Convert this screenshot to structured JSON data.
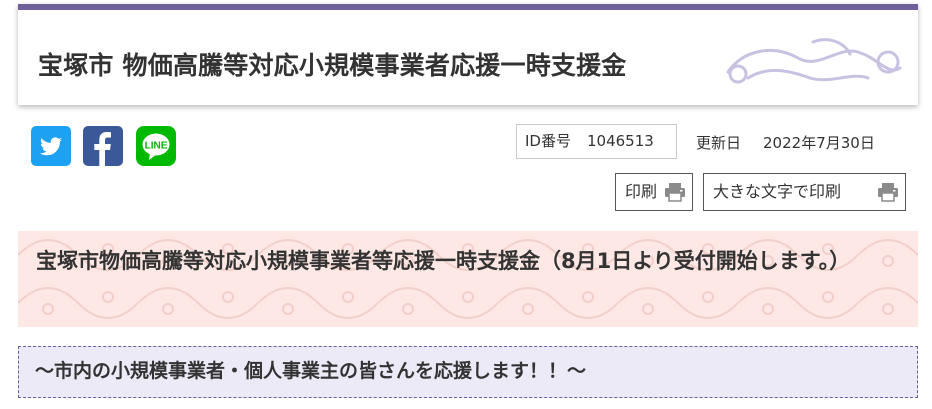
{
  "page": {
    "title": "宝塚市 物価高騰等対応小規模事業者応援一時支援金"
  },
  "share": {
    "twitter_icon": "twitter-icon",
    "facebook_icon": "facebook-icon",
    "line_icon": "line-icon",
    "line_label": "LINE"
  },
  "meta": {
    "id_label": "ID番号",
    "id_value": "1046513",
    "updated_label": "更新日",
    "updated_value": "2022年7月30日"
  },
  "print": {
    "print_label": "印刷",
    "print_large_label": "大きな文字で印刷",
    "icon": "printer-icon"
  },
  "content": {
    "heading": "宝塚市物価高騰等対応小規模事業者等応援一時支援金（8月1日より受付開始します。）",
    "subheading": "～市内の小規模事業者・個人事業主の皆さんを応援します！！～"
  },
  "colors": {
    "title_border": "#6f5f9c",
    "twitter": "#1da1f2",
    "facebook": "#3b5998",
    "line": "#00b900",
    "heading_bg": "#fde8e6",
    "subheading_bg": "#edeaf7",
    "subheading_border": "#6a5e9b"
  }
}
